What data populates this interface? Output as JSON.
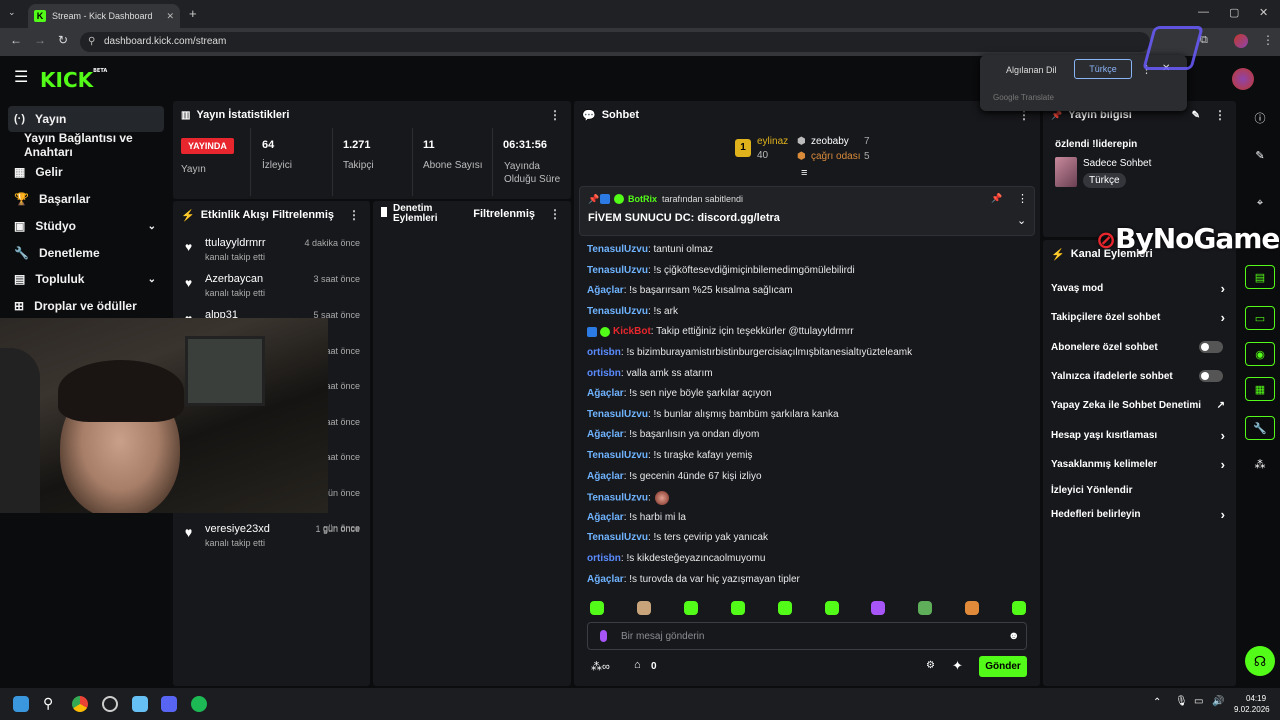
{
  "browser": {
    "tab_title": "Stream - Kick Dashboard",
    "url": "dashboard.kick.com/stream",
    "favicon_letter": "K"
  },
  "header": {
    "logo": "KICK",
    "logo_badge": "BETA"
  },
  "sidebar": {
    "items": [
      {
        "label": "Yayın",
        "icon": "broadcast-icon"
      },
      {
        "label": "Yayın Bağlantısı ve Anahtarı",
        "icon": ""
      },
      {
        "label": "Gelir",
        "icon": "revenue-icon"
      },
      {
        "label": "Başarılar",
        "icon": "trophy-icon"
      },
      {
        "label": "Stüdyo",
        "icon": "studio-icon"
      },
      {
        "label": "Denetleme",
        "icon": "wrench-icon"
      },
      {
        "label": "Topluluk",
        "icon": "community-icon"
      },
      {
        "label": "Droplar ve ödüller",
        "icon": "gift-icon"
      }
    ]
  },
  "stats": {
    "title": "Yayın İstatistikleri",
    "live_badge": "YAYINDA",
    "live_label": "Yayın",
    "viewers_value": "64",
    "viewers_label": "İzleyici",
    "followers_value": "1.271",
    "followers_label": "Takipçi",
    "subs_value": "11",
    "subs_label": "Abone Sayısı",
    "uptime_value": "06:31:56",
    "uptime_label": "Yayında Olduğu Süre"
  },
  "activity": {
    "title": "Etkinlik Akışı",
    "filter": "Filtrelenmiş",
    "events": [
      {
        "name": "ttulayyldrmrr",
        "sub": "kanalı takip etti",
        "time": "4 dakika önce"
      },
      {
        "name": "Azerbaycan",
        "sub": "kanalı takip etti",
        "time": "3 saat önce"
      },
      {
        "name": "alpp31",
        "sub": "",
        "time": "5 saat önce"
      },
      {
        "name": "",
        "sub": "",
        "time": "aat önce"
      },
      {
        "name": "",
        "sub": "",
        "time": "aat önce"
      },
      {
        "name": "",
        "sub": "",
        "time": "aat önce"
      },
      {
        "name": "",
        "sub": "",
        "time": "aat önce"
      },
      {
        "name": "",
        "sub": "",
        "time": "gün önce"
      },
      {
        "name": "",
        "sub": "",
        "time": "gün önce"
      },
      {
        "name": "veresiye23xd",
        "sub": "kanalı takip etti",
        "time": "1 gün önce"
      }
    ]
  },
  "moderation": {
    "title_line1": "Denetim",
    "title_line2": "Eylemleri",
    "filter": "Filtrelenmiş"
  },
  "chat": {
    "title": "Sohbet",
    "leaderboard": {
      "first_name": "eylinaz",
      "first_value": "40",
      "second_name": "zeobaby",
      "second_value": "7",
      "third_name": "çağrı odası",
      "third_value": "5",
      "rank_label": "1"
    },
    "pinned_by_name": "BotRix",
    "pinned_by_text": "tarafından sabitlendi",
    "pinned_message": "FİVEM SUNUCU DC: discord.gg/letra",
    "messages": [
      {
        "user": "TenasulUzvu",
        "color": "#6fb3ff",
        "text": ": tantuni olmaz"
      },
      {
        "user": "TenasulUzvu",
        "color": "#6fb3ff",
        "text": ": !s çiğköftesevdiğimiçinbilemedimgömülebilirdi"
      },
      {
        "user": "Ağaçlar",
        "color": "#6fb3ff",
        "text": ": !s başarırsam %25 kısalma sağlıcam"
      },
      {
        "user": "TenasulUzvu",
        "color": "#6fb3ff",
        "text": ": !s ark"
      },
      {
        "user": "KickBot",
        "color": "#e8262d",
        "text": ": Takip ettiğiniz için teşekkürler @ttulayyldrmrr"
      },
      {
        "user": "ortisbn",
        "color": "#5a8cff",
        "text": ": !s bizimburayamistırbistinburgercisiaçılmışbitanesialtıyüzteleamk"
      },
      {
        "user": "ortisbn",
        "color": "#5a8cff",
        "text": ": valla amk ss atarım"
      },
      {
        "user": "Ağaçlar",
        "color": "#6fb3ff",
        "text": ": !s sen niye böyle şarkılar açıyon"
      },
      {
        "user": "TenasulUzvu",
        "color": "#6fb3ff",
        "text": ": !s bunlar alışmış bambüm şarkılara kanka"
      },
      {
        "user": "Ağaçlar",
        "color": "#6fb3ff",
        "text": ": !s başarılısın ya ondan diyom"
      },
      {
        "user": "TenasulUzvu",
        "color": "#6fb3ff",
        "text": ": !s tıraşke kafayı yemiş"
      },
      {
        "user": "Ağaçlar",
        "color": "#6fb3ff",
        "text": ": !s gecenin 4ünde 67 kişi izliyo"
      },
      {
        "user": "TenasulUzvu",
        "color": "#6fb3ff",
        "text": ":"
      },
      {
        "user": "Ağaçlar",
        "color": "#6fb3ff",
        "text": ": !s harbi mi la"
      },
      {
        "user": "TenasulUzvu",
        "color": "#6fb3ff",
        "text": ": !s ters çevirip yak yanıcak"
      },
      {
        "user": "ortisbn",
        "color": "#5a8cff",
        "text": ": !s kikdesteğeyazıncaolmuyomu"
      },
      {
        "user": "Ağaçlar",
        "color": "#6fb3ff",
        "text": ": !s turovda da var hiç yazışmayan tipler"
      }
    ],
    "input_placeholder": "Bir mesaj gönderin",
    "points_value": "0",
    "send_label": "Gönder"
  },
  "stream_info": {
    "title": "Yayın bilgisi",
    "stream_title": "özlendi !liderepin",
    "category": "Sadece Sohbet",
    "language": "Türkçe"
  },
  "channel_actions": {
    "title": "Kanal Eylemleri",
    "items": [
      {
        "label": "Yavaş mod",
        "kind": "arrow"
      },
      {
        "label": "Takipçilere özel sohbet",
        "kind": "arrow"
      },
      {
        "label": "Abonelere özel sohbet",
        "kind": "toggle"
      },
      {
        "label": "Yalnızca ifadelerle sohbet",
        "kind": "toggle"
      },
      {
        "label": "Yapay Zeka ile Sohbet Denetimi",
        "kind": "external"
      },
      {
        "label": "Hesap yaşı kısıtlaması",
        "kind": "arrow"
      },
      {
        "label": "Yasaklanmış kelimeler",
        "kind": "arrow"
      },
      {
        "label": "İzleyici Yönlendir",
        "kind": "none"
      },
      {
        "label": "Hedefleri belirleyin",
        "kind": "arrow"
      }
    ]
  },
  "translate_popup": {
    "detected": "Algılanan Dil",
    "target": "Türkçe",
    "brand": "Google Translate"
  },
  "watermark": "ByNoGame",
  "taskbar": {
    "time": "04:19",
    "date": "9.02.2026"
  },
  "colors": {
    "accent": "#53fc18",
    "live": "#e8262d",
    "panel": "#17181c"
  }
}
